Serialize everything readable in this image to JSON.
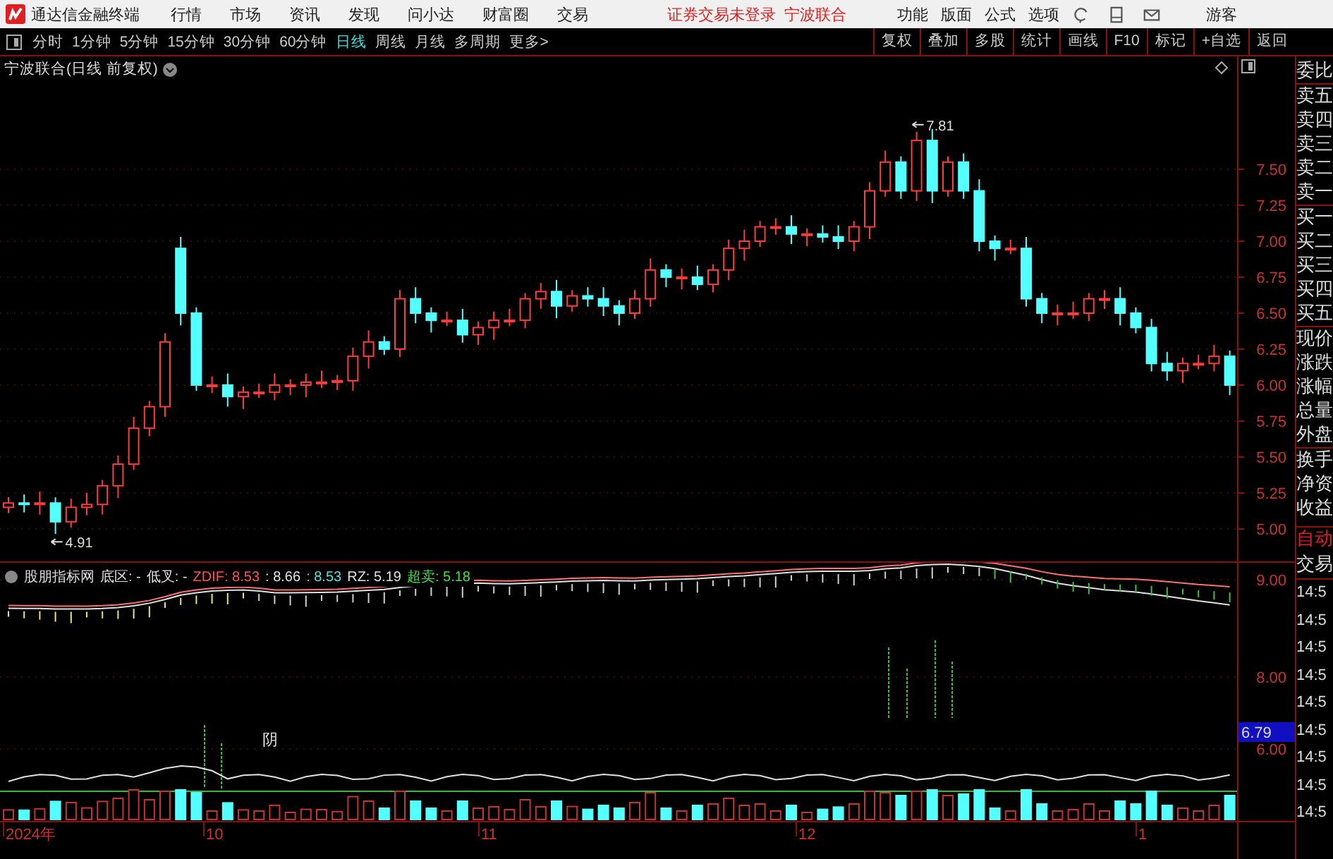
{
  "app_bar": {
    "title": "通达信金融终端",
    "menus": [
      "行情",
      "市场",
      "资讯",
      "发现",
      "问小达",
      "财富圈",
      "交易"
    ],
    "login_status": "证券交易未登录",
    "stock_name": "宁波联合",
    "tools": [
      "功能",
      "版面",
      "公式",
      "选项"
    ],
    "user": "游客"
  },
  "periods": [
    {
      "label": "分时",
      "selected": false
    },
    {
      "label": "1分钟",
      "selected": false
    },
    {
      "label": "5分钟",
      "selected": false
    },
    {
      "label": "15分钟",
      "selected": false
    },
    {
      "label": "30分钟",
      "selected": false
    },
    {
      "label": "60分钟",
      "selected": false
    },
    {
      "label": "日线",
      "selected": true
    },
    {
      "label": "周线",
      "selected": false
    },
    {
      "label": "月线",
      "selected": false
    },
    {
      "label": "多周期",
      "selected": false
    },
    {
      "label": "更多>",
      "selected": false
    }
  ],
  "actions": [
    "复权",
    "叠加",
    "多股",
    "统计",
    "画线",
    "F10",
    "标记",
    "+自选",
    "返回"
  ],
  "chart": {
    "title": "宁波联合(日线 前复权)",
    "price_ticks": [
      "7.50",
      "7.25",
      "7.00",
      "6.75",
      "6.50",
      "6.25",
      "6.00",
      "5.75",
      "5.50",
      "5.25",
      "5.00"
    ],
    "high_label": "7.81",
    "low_label": "4.91"
  },
  "indicator": {
    "name": "股朋指标网",
    "fields": [
      {
        "text": "底区: -",
        "color": "#e0e0e0"
      },
      {
        "text": "低叉: -",
        "color": "#e0e0e0"
      },
      {
        "text": "ZDIF: 8.53",
        "color": "#ff5050"
      },
      {
        "text": ": 8.66",
        "color": "#e0e0e0"
      },
      {
        "text": ": 8.53",
        "color": "#50e0e0"
      },
      {
        "text": "RZ: 5.19",
        "color": "#e0e0e0"
      },
      {
        "text": "超卖: 5.18",
        "color": "#40e040"
      }
    ],
    "ticks": [
      "9.00",
      "8.00",
      "6.00"
    ],
    "current_value": "6.79",
    "annotation": "阴"
  },
  "date_axis": [
    "2024年",
    "10",
    "11",
    "12",
    "1"
  ],
  "quote_panel": {
    "labels": [
      "委比",
      "卖五",
      "卖四",
      "卖三",
      "卖二",
      "卖一",
      "买一",
      "买二",
      "买三",
      "买四",
      "买五",
      "现价",
      "涨跌",
      "涨幅",
      "总量",
      "外盘",
      "换手",
      "净资",
      "收益"
    ],
    "mode": "自动",
    "trade": "交易",
    "times": [
      "14:5",
      "14:5",
      "14:5",
      "14:5",
      "14:5",
      "14:5",
      "14:5",
      "14:5",
      "14:5"
    ]
  }
}
